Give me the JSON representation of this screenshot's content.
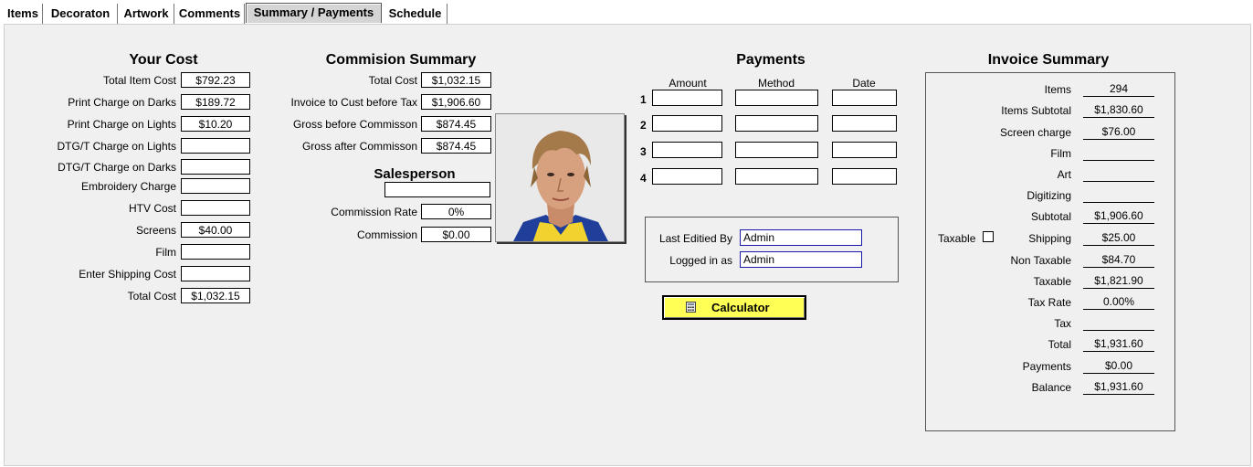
{
  "tabs": [
    "Items",
    "Decoraton",
    "Artwork",
    "Comments",
    "Summary / Payments",
    "Schedule"
  ],
  "your_cost": {
    "title": "Your Cost",
    "rows": [
      {
        "label": "Total Item Cost",
        "value": "$792.23"
      },
      {
        "label": "Print Charge on Darks",
        "value": "$189.72"
      },
      {
        "label": "Print Charge on Lights",
        "value": "$10.20"
      },
      {
        "label": "DTG/T Charge on Lights",
        "value": ""
      },
      {
        "label": "DTG/T Charge on Darks",
        "value": ""
      },
      {
        "label": "Embroidery Charge",
        "value": ""
      },
      {
        "label": "HTV Cost",
        "value": ""
      },
      {
        "label": "Screens",
        "value": "$40.00"
      },
      {
        "label": "Film",
        "value": ""
      },
      {
        "label": "Enter Shipping Cost",
        "value": ""
      },
      {
        "label": "Total Cost",
        "value": "$1,032.15"
      }
    ]
  },
  "commission": {
    "title": "Commision Summary",
    "rows": [
      {
        "label": "Total Cost",
        "value": "$1,032.15"
      },
      {
        "label": "Invoice to Cust before Tax",
        "value": "$1,906.60"
      },
      {
        "label": "Gross before Commisson",
        "value": "$874.45"
      },
      {
        "label": "Gross after Commisson",
        "value": "$874.45"
      }
    ],
    "salesperson_title": "Salesperson",
    "salesperson": "",
    "rate_label": "Commission Rate",
    "rate": "0%",
    "commission_label": "Commission",
    "commission_value": "$0.00"
  },
  "payments": {
    "title": "Payments",
    "columns": [
      "Amount",
      "Method",
      "Date"
    ],
    "rows": [
      {
        "num": "1",
        "amount": "",
        "method": "",
        "date": ""
      },
      {
        "num": "2",
        "amount": "",
        "method": "",
        "date": ""
      },
      {
        "num": "3",
        "amount": "",
        "method": "",
        "date": ""
      },
      {
        "num": "4",
        "amount": "",
        "method": "",
        "date": ""
      }
    ]
  },
  "edit_info": {
    "last_edited_label": "Last Editied By",
    "last_edited_value": "Admin",
    "logged_in_label": "Logged in as",
    "logged_in_value": "Admin"
  },
  "calculator_label": "Calculator",
  "invoice": {
    "title": "Invoice Summary",
    "taxable_checkbox_label": "Taxable",
    "rows": [
      {
        "label": "Items",
        "value": "294"
      },
      {
        "label": "Items Subtotal",
        "value": "$1,830.60"
      },
      {
        "label": "Screen charge",
        "value": "$76.00"
      },
      {
        "label": "Film",
        "value": ""
      },
      {
        "label": "Art",
        "value": ""
      },
      {
        "label": "Digitizing",
        "value": ""
      },
      {
        "label": "Subtotal",
        "value": "$1,906.60"
      },
      {
        "label": "Shipping",
        "value": "$25.00"
      },
      {
        "label": "Non Taxable",
        "value": "$84.70"
      },
      {
        "label": "Taxable",
        "value": "$1,821.90"
      },
      {
        "label": "Tax Rate",
        "value": "0.00%"
      },
      {
        "label": "Tax",
        "value": ""
      },
      {
        "label": "Total",
        "value": "$1,931.60"
      },
      {
        "label": "Payments",
        "value": "$0.00"
      },
      {
        "label": "Balance",
        "value": "$1,931.60"
      }
    ]
  }
}
